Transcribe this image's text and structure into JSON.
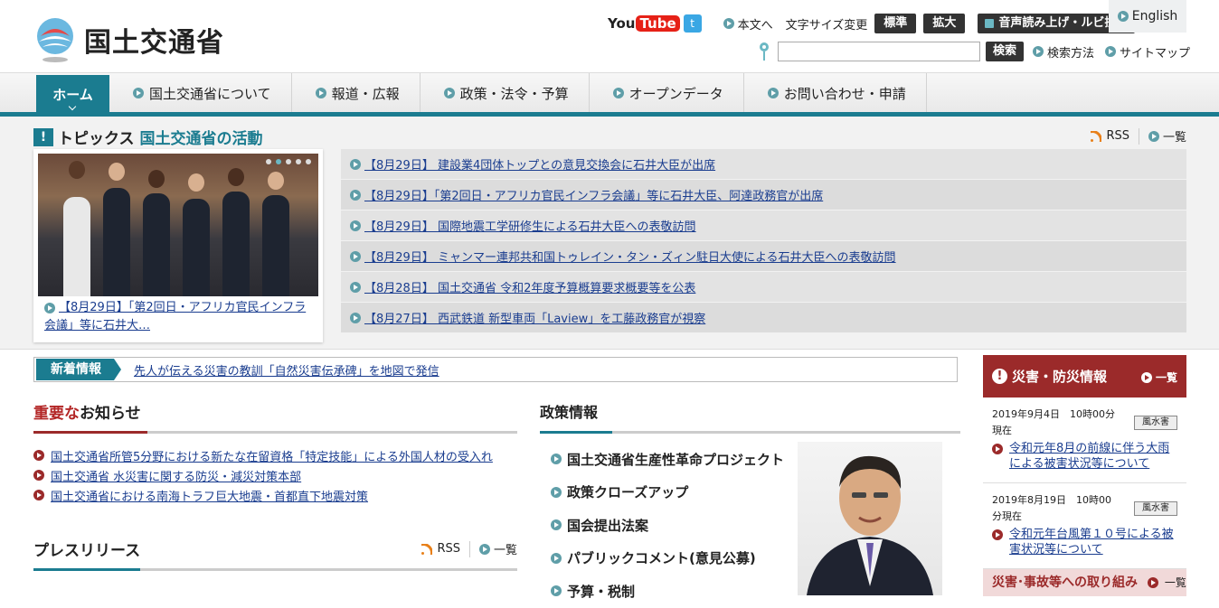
{
  "header": {
    "site_name": "国土交通省",
    "youtube_you": "You",
    "youtube_tube": "Tube",
    "honbun": "本文へ",
    "fontsize_label": "文字サイズ変更",
    "standard": "標準",
    "enlarge": "拡大",
    "voice": "音声読み上げ・ルビ振り",
    "english": "English",
    "search_button": "検索",
    "search_value": "",
    "search_method": "検索方法",
    "sitemap": "サイトマップ"
  },
  "nav": {
    "items": [
      "ホーム",
      "国土交通省について",
      "報道・広報",
      "政策・法令・予算",
      "オープンデータ",
      "お問い合わせ・申請"
    ]
  },
  "topics": {
    "title": "トピックス",
    "subtitle": "国土交通省の活動",
    "rss": "RSS",
    "all": "一覧",
    "feature_caption": "【8月29日】「第2回日・アフリカ官民インフラ会議」等に石井大…",
    "items": [
      "【8月29日】 建設業4団体トップとの意見交換会に石井大臣が出席",
      "【8月29日】「第2回日・アフリカ官民インフラ会議」等に石井大臣、阿達政務官が出席",
      "【8月29日】 国際地震工学研修生による石井大臣への表敬訪問",
      "【8月29日】 ミャンマー連邦共和国トゥレイン・タン・ズィン駐日大使による石井大臣への表敬訪問",
      "【8月28日】 国土交通省 令和2年度予算概算要求概要等を公表",
      "【8月27日】 西武鉄道 新型車両「Laview」を工藤政務官が視察"
    ]
  },
  "newinfo": {
    "label": "新着情報",
    "text": "先人が伝える災害の教訓「自然災害伝承碑」を地図で発信"
  },
  "important": {
    "title_red": "重要な",
    "title_rest": "お知らせ",
    "items": [
      "国土交通省所管5分野における新たな在留資格「特定技能」による外国人材の受入れ",
      "国土交通省 水災害に関する防災・減災対策本部",
      "国土交通省における南海トラフ巨大地震・首都直下地震対策"
    ]
  },
  "press": {
    "title": "プレスリリース",
    "rss": "RSS",
    "all": "一覧"
  },
  "policy": {
    "title": "政策情報",
    "items": [
      "国土交通省生産性革命プロジェクト",
      "政策クローズアップ",
      "国会提出法案",
      "パブリックコメント(意見公募)",
      "予算・税制"
    ]
  },
  "disaster": {
    "title": "災害・防災情報",
    "all": "一覧",
    "items": [
      {
        "date": "2019年9月4日　10時00分",
        "tag": "風水害",
        "status": "現在",
        "text": "令和元年8月の前線に伴う大雨による被害状況等について"
      },
      {
        "date": "2019年8月19日　10時00",
        "tag": "風水害",
        "status": "分現在",
        "text": "令和元年台風第１０号による被害状況等について"
      }
    ],
    "more": "災害･事故等への取り組み",
    "more_all": "一覧"
  },
  "colors": {
    "teal": "#1b7c90",
    "red": "#9b2a2a",
    "link": "#1a3d8f"
  }
}
